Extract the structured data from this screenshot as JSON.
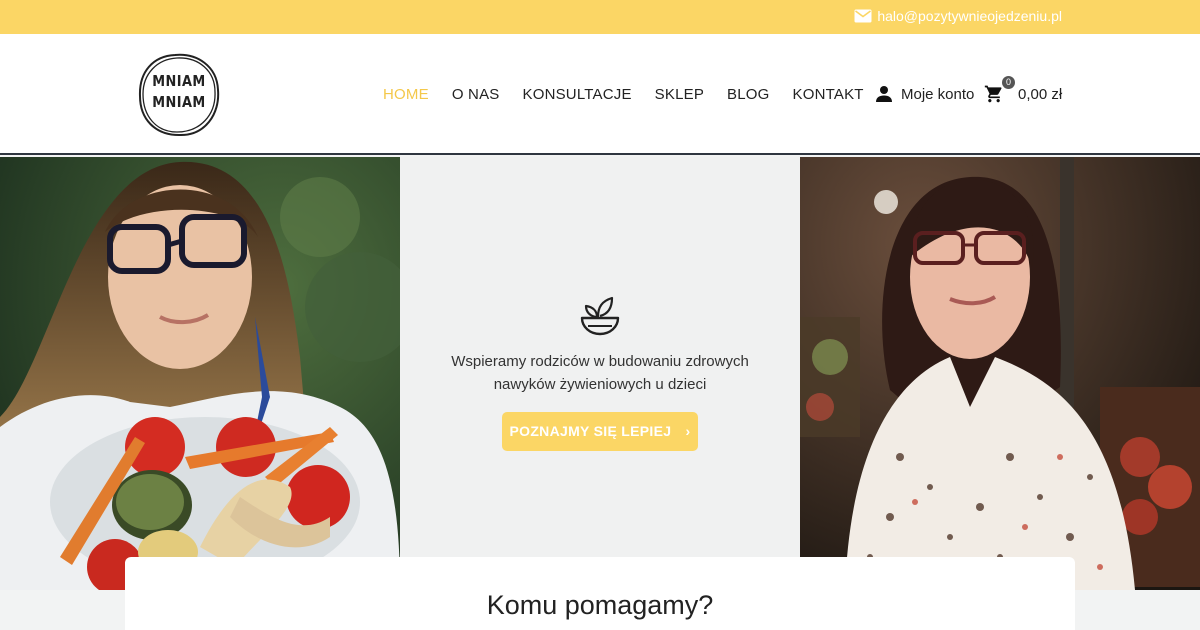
{
  "topbar": {
    "email": "halo@pozytywnieojedzeniu.pl",
    "email_icon": "mail-icon"
  },
  "header": {
    "logo": {
      "line1": "MNIAM",
      "line2": "MNIAM"
    },
    "nav": [
      {
        "label": "HOME",
        "active": true
      },
      {
        "label": "O NAS",
        "active": false
      },
      {
        "label": "KONSULTACJE",
        "active": false
      },
      {
        "label": "SKLEP",
        "active": false
      },
      {
        "label": "BLOG",
        "active": false
      },
      {
        "label": "KONTAKT",
        "active": false
      }
    ],
    "account": {
      "label": "Moje konto",
      "icon": "user-icon"
    },
    "cart": {
      "count": "0",
      "total": "0,00 zł",
      "icon": "cart-icon"
    }
  },
  "hero": {
    "icon": "salad-bowl-icon",
    "tagline_line1": "Wspieramy rodziców w budowaniu zdrowych",
    "tagline_line2": "nawyków żywieniowych u dzieci",
    "cta_label": "POZNAJMY SIĘ LEPIEJ",
    "cta_icon": "chevron-right-icon",
    "left_photo": "photo-woman-holding-vegetable-bowl",
    "right_photo": "photo-woman-in-floral-blouse"
  },
  "section": {
    "title": "Komu pomagamy?"
  },
  "colors": {
    "accent": "#fbd665",
    "nav_active": "#f4c84a",
    "text": "#222222",
    "hero_bg": "#f0f1f1"
  }
}
